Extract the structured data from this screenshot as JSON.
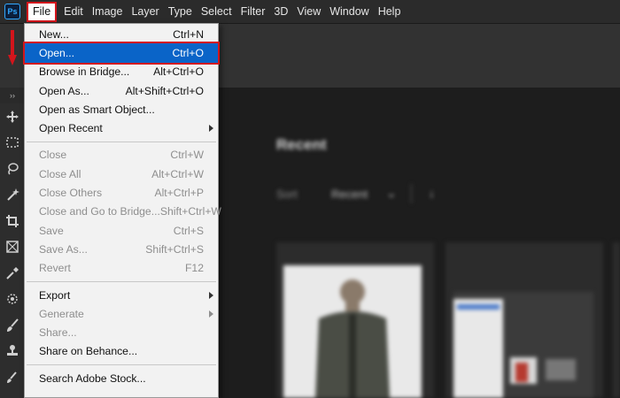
{
  "menubar": {
    "app_icon": "Ps",
    "items": [
      {
        "label": "File",
        "active": true
      },
      {
        "label": "Edit"
      },
      {
        "label": "Image"
      },
      {
        "label": "Layer"
      },
      {
        "label": "Type"
      },
      {
        "label": "Select"
      },
      {
        "label": "Filter"
      },
      {
        "label": "3D"
      },
      {
        "label": "View"
      },
      {
        "label": "Window"
      },
      {
        "label": "Help"
      }
    ]
  },
  "file_menu": {
    "groups": [
      [
        {
          "label": "New...",
          "shortcut": "Ctrl+N",
          "enabled": true
        },
        {
          "label": "Open...",
          "shortcut": "Ctrl+O",
          "enabled": true,
          "highlighted": true
        },
        {
          "label": "Browse in Bridge...",
          "shortcut": "Alt+Ctrl+O",
          "enabled": true
        },
        {
          "label": "Open As...",
          "shortcut": "Alt+Shift+Ctrl+O",
          "enabled": true
        },
        {
          "label": "Open as Smart Object...",
          "shortcut": "",
          "enabled": true
        },
        {
          "label": "Open Recent",
          "shortcut": "",
          "enabled": true,
          "submenu": true
        }
      ],
      [
        {
          "label": "Close",
          "shortcut": "Ctrl+W",
          "enabled": false
        },
        {
          "label": "Close All",
          "shortcut": "Alt+Ctrl+W",
          "enabled": false
        },
        {
          "label": "Close Others",
          "shortcut": "Alt+Ctrl+P",
          "enabled": false
        },
        {
          "label": "Close and Go to Bridge...",
          "shortcut": "Shift+Ctrl+W",
          "enabled": false
        },
        {
          "label": "Save",
          "shortcut": "Ctrl+S",
          "enabled": false
        },
        {
          "label": "Save As...",
          "shortcut": "Shift+Ctrl+S",
          "enabled": false
        },
        {
          "label": "Revert",
          "shortcut": "F12",
          "enabled": false
        }
      ],
      [
        {
          "label": "Export",
          "shortcut": "",
          "enabled": true,
          "submenu": true
        },
        {
          "label": "Generate",
          "shortcut": "",
          "enabled": false,
          "submenu": true
        },
        {
          "label": "Share...",
          "shortcut": "",
          "enabled": false
        },
        {
          "label": "Share on Behance...",
          "shortcut": "",
          "enabled": true
        }
      ],
      [
        {
          "label": "Search Adobe Stock...",
          "shortcut": "",
          "enabled": true
        }
      ]
    ]
  },
  "workspace": {
    "heading": "Recent",
    "sort_label": "Sort",
    "sort_value": "Recent"
  },
  "toolbar": {
    "collapse_glyph": "››",
    "tools": [
      "move-icon",
      "marquee-icon",
      "lasso-icon",
      "magic-wand-icon",
      "crop-icon",
      "frame-icon",
      "eyedropper-icon",
      "spot-healing-icon",
      "brush-icon",
      "stamp-icon",
      "history-brush-icon"
    ]
  },
  "colors": {
    "highlight": "#0a64c8",
    "annotation_red": "#d3151c",
    "menu_bg": "#f2f2f2"
  }
}
